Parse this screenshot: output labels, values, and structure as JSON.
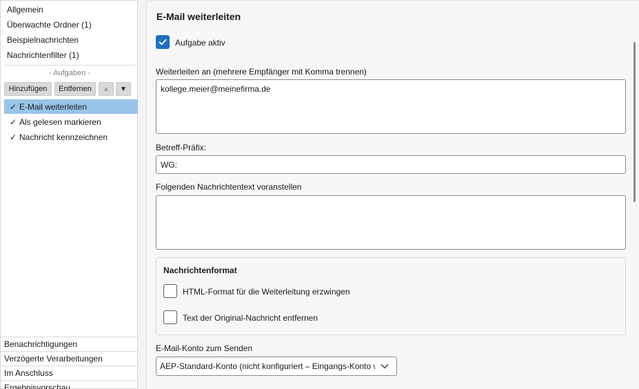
{
  "sidebar": {
    "top_items": [
      "Allgemein",
      "Überwachte Ordner (1)",
      "Beispielnachrichten",
      "Nachrichtenfilter (1)"
    ],
    "tasks_section_label": "- Aufgaben -",
    "buttons": {
      "add": "Hinzufügen",
      "remove": "Entfernen",
      "up": "▲",
      "down": "▼"
    },
    "tasks": [
      {
        "label": "E-Mail weiterleiten",
        "check": "✓",
        "selected": true
      },
      {
        "label": "Als gelesen markieren",
        "check": "✓",
        "selected": false
      },
      {
        "label": "Nachricht kennzeichnen",
        "check": "✓",
        "selected": false
      }
    ],
    "bottom_items": [
      "Benachrichtigungen",
      "Verzögerte Verarbeitungen",
      "Im Anschluss",
      "Ergebnisvorschau"
    ]
  },
  "main": {
    "title": "E-Mail weiterleiten",
    "task_active_label": "Aufgabe aktiv",
    "task_active_checked": true,
    "forward_to_label": "Weiterleiten an (mehrere Empfänger mit Komma trennen)",
    "forward_to_value": "kollege.meier@meinefirma.de",
    "subject_prefix_label": "Betreff-Präfix:",
    "subject_prefix_value": "WG:",
    "prepend_text_label": "Folgenden Nachrichtentext voranstellen",
    "prepend_text_value": "",
    "format_group": {
      "title": "Nachrichtenformat",
      "force_html_label": "HTML-Format für die Weiterleitung erzwingen",
      "force_html_checked": false,
      "remove_original_label": "Text der Original-Nachricht entfernen",
      "remove_original_checked": false
    },
    "send_account_label": "E-Mail-Konto zum Senden",
    "send_account_value": "AEP-Standard-Konto (nicht konfiguriert – Eingangs-Konto wird verwendet)"
  },
  "colors": {
    "accent": "#1f6fbe",
    "selection": "#99c4ea"
  }
}
